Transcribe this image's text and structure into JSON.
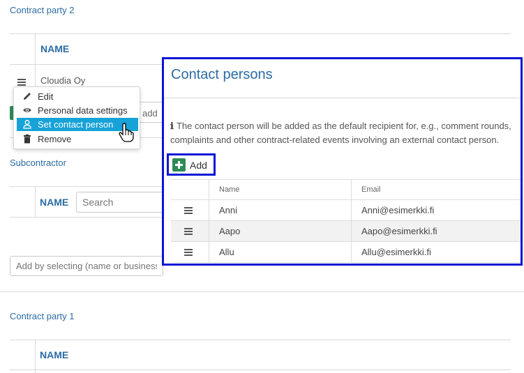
{
  "party2": {
    "title": "Contract party 2",
    "col_name": "NAME",
    "row_name": "Cloudia Oy",
    "partial_input": "add"
  },
  "context_menu": {
    "items": [
      {
        "label": "Edit",
        "icon": "pencil-icon"
      },
      {
        "label": "Personal data settings",
        "icon": "eye-icon"
      },
      {
        "label": "Set contact person",
        "icon": "person-icon",
        "active": true
      },
      {
        "label": "Remove",
        "icon": "trash-icon"
      }
    ]
  },
  "subcontractor": {
    "title": "Subcontractor",
    "col_name": "NAME",
    "search_placeholder": "Search",
    "add_placeholder": "Add by selecting (name or business"
  },
  "party1": {
    "title": "Contract party 1",
    "col_name": "NAME"
  },
  "modal": {
    "title": "Contact persons",
    "info_icon": "info-icon",
    "info_text": "The contact person will be added as the default recipient for, e.g., comment rounds, complaints and other contract-related events involving an external contact person.",
    "add_label": "Add",
    "columns": [
      "",
      "Name",
      "Email"
    ],
    "rows": [
      {
        "name": "Anni",
        "email": "Anni@esimerkki.fi"
      },
      {
        "name": "Aapo",
        "email": "Aapo@esimerkki.fi"
      },
      {
        "name": "Allu",
        "email": "Allu@esimerkki.fi"
      }
    ]
  },
  "colors": {
    "accent": "#2a6ba5",
    "highlight": "#0a16d6",
    "menu_active": "#17a2d8",
    "add_green": "#2e8b57"
  }
}
